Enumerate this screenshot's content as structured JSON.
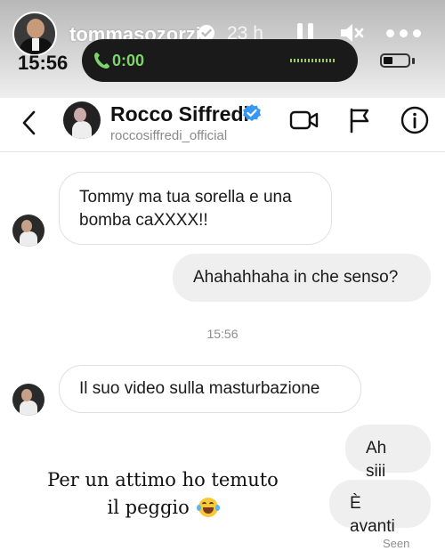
{
  "story": {
    "username": "tommasozorzi",
    "time_ago": "23 h"
  },
  "status_bar": {
    "clock": "15:56",
    "call_timer": "0:00"
  },
  "chat_header": {
    "name": "Rocco Siffredi",
    "handle": "roccosiffredi_official"
  },
  "messages": [
    {
      "from": "them",
      "lines": [
        "Tommy ma tua sorella e una",
        "bomba caXXXX!!"
      ]
    },
    {
      "from": "me",
      "lines": [
        "Ahahahhaha in che senso?"
      ]
    },
    {
      "from": "them",
      "lines": [
        "Il suo video sulla masturbazione"
      ]
    },
    {
      "from": "me",
      "lines": [
        "Ah siii"
      ]
    },
    {
      "from": "me",
      "lines": [
        "È avanti"
      ]
    }
  ],
  "timestamp": "15:56",
  "seen_label": "Seen",
  "caption": {
    "line1": "Per un attimo ho temuto",
    "line2": "il peggio"
  },
  "colors": {
    "call_green": "#7dd46a",
    "verified_blue": "#3897f0",
    "sent_bubble": "#efefef"
  },
  "icons": [
    "pause-icon",
    "mute-icon",
    "more-icon",
    "phone-icon",
    "back-icon",
    "verified-icon",
    "video-call-icon",
    "flag-icon",
    "info-icon",
    "laughing-emoji"
  ]
}
